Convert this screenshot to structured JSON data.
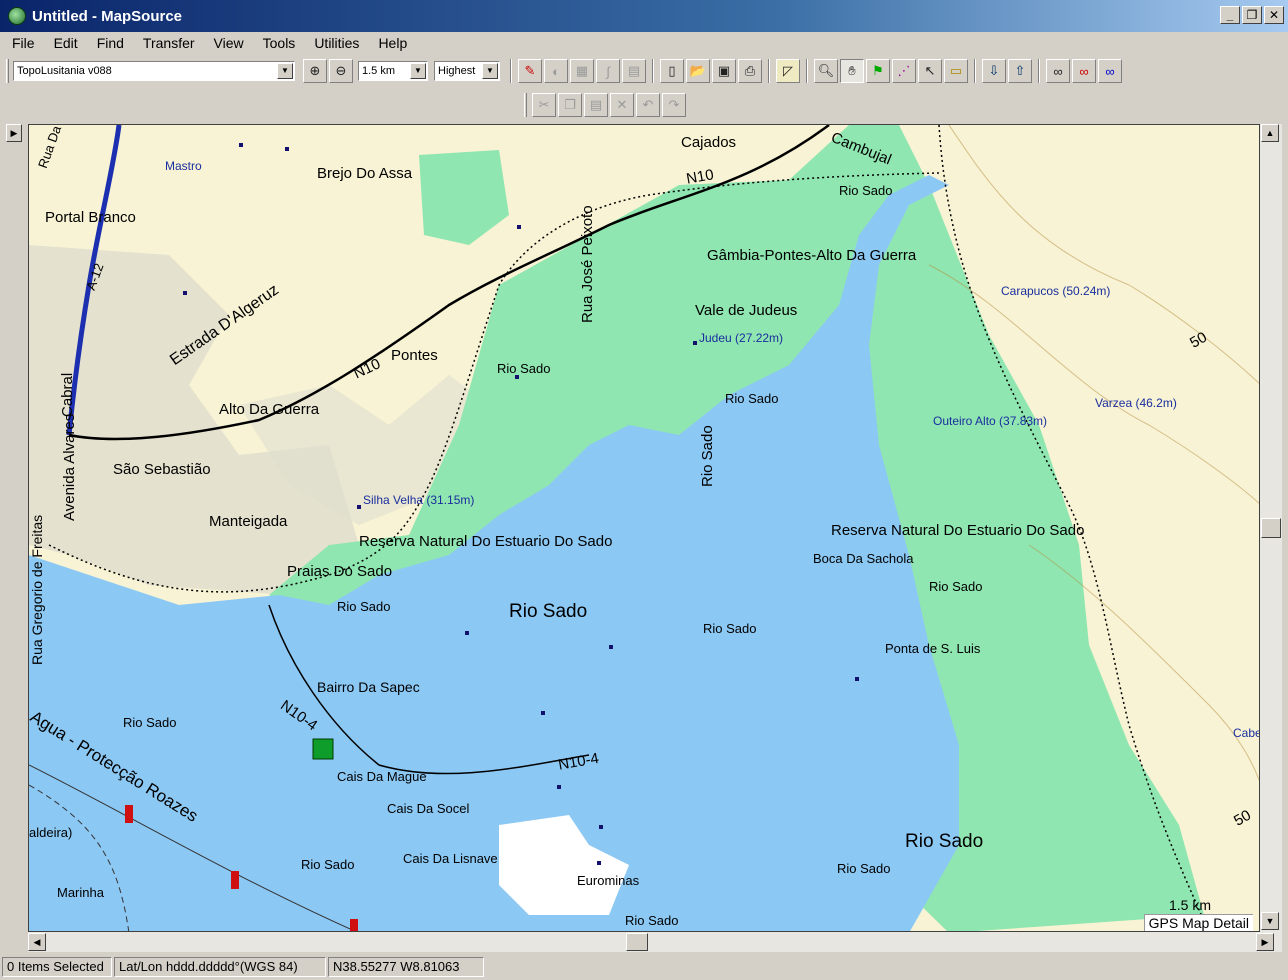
{
  "window": {
    "title": "Untitled - MapSource",
    "buttons": {
      "minimize": "_",
      "restore": "❐",
      "close": "✕"
    }
  },
  "menu": [
    "File",
    "Edit",
    "Find",
    "Transfer",
    "View",
    "Tools",
    "Utilities",
    "Help"
  ],
  "toolbar": {
    "map_product": "TopoLusitania v088",
    "zoom_level": "1.5 km",
    "detail": "Highest"
  },
  "map": {
    "labels": {
      "mastro": "Mastro",
      "brejo": "Brejo Do Assa",
      "portal_branco": "Portal Branco",
      "estrada": "Estrada D'Algeruz",
      "a12": "A-12",
      "n10_west": "N10",
      "pontes": "Pontes",
      "alto_guerra": "Alto Da Guerra",
      "cabral": "Cabral",
      "alvares": "Avenida Alvares",
      "sao_sebastiao": "São Sebastião",
      "manteigada": "Manteigada",
      "gregorio": "Rua Gregorio de Freitas",
      "silha_velha": "Silha Velha (31.15m)",
      "reserva_west": "Reserva Natural Do Estuario Do Sado",
      "praias": "Praias Do Sado",
      "rio_sado_main": "Rio Sado",
      "rio_sado_1": "Rio Sado",
      "rio_sado_2": "Rio Sado",
      "rio_sado_3": "Rio Sado",
      "rio_sado_4": "Rio Sado",
      "rio_sado_5": "Rio Sado",
      "rio_sado_6": "Rio Sado",
      "rio_sado_7": "Rio Sado",
      "rio_sado_8": "Rio Sado",
      "rio_sado_9": "Rio Sado",
      "rio_sado_10": "Rio Sado",
      "rio_sado_vert": "Rio Sado",
      "rio_sado_big": "Rio Sado",
      "cajados": "Cajados",
      "cambujal": "Cambujal",
      "n10_east": "N10",
      "rua_jose": "Rua José Peixoto",
      "gambia": "Gâmbia-Pontes-Alto Da Guerra",
      "vale_judeus": "Vale de Judeus",
      "judeu": "Judeu (27.22m)",
      "carapucos": "Carapucos (50.24m)",
      "varzea": "Varzea (46.2m)",
      "outeiro": "Outeiro Alto (37.83m)",
      "fifty_1": "50",
      "fifty_2": "50",
      "reserva_east": "Reserva Natural Do Estuario Do Sado",
      "boca": "Boca Da Sachola",
      "ponta": "Ponta de S. Luis",
      "bairro": "Bairro Da Sapec",
      "n10_4_a": "N10-4",
      "n10_4_b": "N10-4",
      "cais_mague": "Cais Da Mague",
      "cais_socel": "Cais Da Socel",
      "cais_lisnave": "Cais Da Lisnave",
      "eurominas": "Eurominas",
      "agua": "Agua - Protecção Roazes",
      "caldeira": "aldeira)",
      "marinha": "Marinha",
      "cabe": "Cabe",
      "rua_da": "Rua Da"
    },
    "scale": "1.5 km",
    "detail_note": "GPS Map Detail"
  },
  "status": {
    "selected": "0 Items Selected",
    "format": "Lat/Lon hddd.ddddd°(WGS 84)",
    "coords": "N38.55277 W8.81063"
  }
}
